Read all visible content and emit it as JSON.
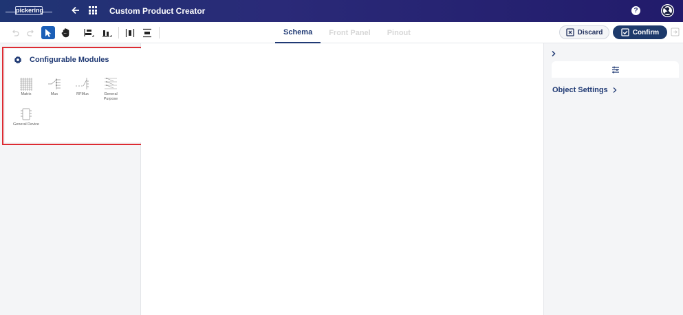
{
  "header": {
    "logo_text": "pickering",
    "title": "Custom Product Creator",
    "help_label": "?"
  },
  "toolbar": {
    "tools": [
      "undo-icon",
      "redo-icon",
      "pointer-icon",
      "hand-icon",
      "align-left-icon",
      "align-bottom-icon",
      "distribute-horizontal-icon",
      "distribute-vertical-icon"
    ],
    "active_tool": "pointer-icon",
    "tabs": [
      {
        "label": "Schema",
        "active": true
      },
      {
        "label": "Front Panel",
        "active": false
      },
      {
        "label": "Pinout",
        "active": false
      }
    ],
    "discard_label": "Discard",
    "confirm_label": "Confirm"
  },
  "modules_panel": {
    "title": "Configurable Modules",
    "items": [
      {
        "label": "Matrix",
        "icon": "matrix-icon"
      },
      {
        "label": "Mux",
        "icon": "mux-icon"
      },
      {
        "label": "RFMux",
        "icon": "rfmux-icon"
      },
      {
        "label": "General Purpose",
        "icon": "general-purpose-icon"
      },
      {
        "label": "General Device",
        "icon": "general-device-icon"
      }
    ]
  },
  "right_panel": {
    "object_settings_label": "Object Settings"
  },
  "colors": {
    "header": "#222a6c",
    "primary": "#203a74",
    "active_tool": "#1b5fb7",
    "highlight": "#dd2b32",
    "panel_bg": "#f4f5f7"
  }
}
